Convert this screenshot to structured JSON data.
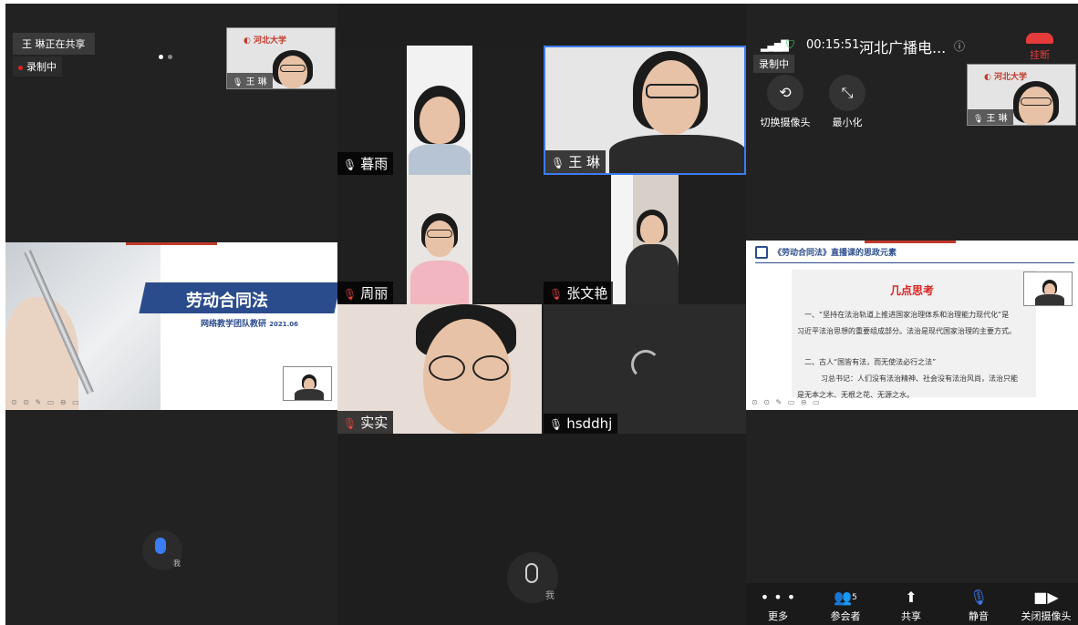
{
  "panel1": {
    "sharing_text": "王 琳正在共享",
    "recording_text": "录制中",
    "thumb_name": "王 琳",
    "slide": {
      "title": "劳动合同法",
      "subtitle": "网络教学团队教研",
      "date": "2021.06"
    },
    "self_label": "我"
  },
  "panel2": {
    "participants": [
      {
        "name": "暮雨",
        "mic": "on"
      },
      {
        "name": "王 琳",
        "mic": "on"
      },
      {
        "name": "周丽",
        "mic": "off"
      },
      {
        "name": "张文艳",
        "mic": "off"
      },
      {
        "name": "实实",
        "mic": "off"
      },
      {
        "name": "hsddhj",
        "mic": "on"
      }
    ],
    "self_label": "我"
  },
  "panel3": {
    "timer": "00:15:51",
    "channel": "河北广播电...",
    "hangup_label": "挂断",
    "recording_text": "录制中",
    "switch_camera_label": "切换摄像头",
    "minimize_label": "最小化",
    "thumb_name": "王 琳",
    "slide": {
      "header": "《劳动合同法》直播课的思政元素",
      "title": "几点思考",
      "line1": "一、“坚持在法治轨道上推进国家治理体系和治理能力现代化”是",
      "line2": "习近平法治思想的重要组成部分。法治是现代国家治理的主要方式。",
      "line3": "二、古人“国皆有法，而无使法必行之法”",
      "line4": "习总书记：人们没有法治精神、社会没有法治风尚，法治只能",
      "line5": "是无本之木、无根之花、无源之水。"
    },
    "bottom_bar": {
      "more": "更多",
      "participants": "参会者",
      "participants_count": "5",
      "share": "共享",
      "mute": "静音",
      "camera_off": "关闭摄像头"
    }
  },
  "colors": {
    "accent_blue": "#3b7cf2",
    "hangup_red": "#e53b3b",
    "slide_blue": "#2b4c8c",
    "shield_green": "#3fcf62"
  }
}
